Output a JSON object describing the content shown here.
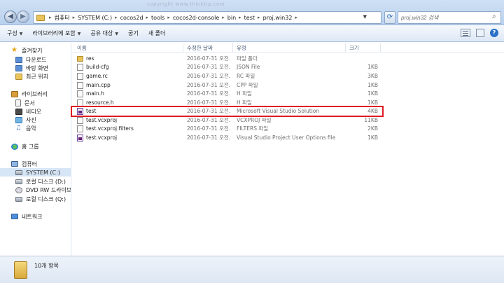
{
  "address_bar": {
    "crumbs": [
      "컴퓨터",
      "SYSTEM (C:)",
      "cocos2d",
      "tools",
      "cocos2d-console",
      "bin",
      "test",
      "proj.win32"
    ],
    "search_placeholder": "proj.win32 검색",
    "watermark": "copyright www.thinktip.com"
  },
  "toolbar": {
    "organize": "구성",
    "include_library": "라이브러리에 포함",
    "share": "공유 대상",
    "burn": "굽기",
    "new_folder": "새 폴더"
  },
  "nav": {
    "favorites": "즐겨찾기",
    "downloads": "다운로드",
    "desktop": "바탕 화면",
    "recent": "최근 위치",
    "libraries": "라이브러리",
    "documents": "문서",
    "videos": "비디오",
    "pictures": "사진",
    "music": "음악",
    "homegroup": "홈 그룹",
    "computer": "컴퓨터",
    "system_c": "SYSTEM (C:)",
    "local_d": "로컬 디스크 (D:)",
    "dvd": "DVD RW 드라이브 (",
    "local_q": "로컬 디스크 (Q:)",
    "network": "네트워크"
  },
  "columns": {
    "name": "이름",
    "date": "수정한 날짜",
    "type": "유형",
    "size": "크기"
  },
  "files": [
    {
      "name": "res",
      "date": "2016-07-31 오전...",
      "type": "파일 폴더",
      "size": "",
      "icon": "folder-icon"
    },
    {
      "name": "build-cfg",
      "date": "2016-07-31 오전...",
      "type": "JSON File",
      "size": "1KB",
      "icon": "file-icon"
    },
    {
      "name": "game.rc",
      "date": "2016-07-31 오전...",
      "type": "RC 파일",
      "size": "3KB",
      "icon": "file-icon"
    },
    {
      "name": "main.cpp",
      "date": "2016-07-31 오전...",
      "type": "CPP 파일",
      "size": "1KB",
      "icon": "file-icon"
    },
    {
      "name": "main.h",
      "date": "2016-07-31 오전...",
      "type": "H 파일",
      "size": "1KB",
      "icon": "file-icon"
    },
    {
      "name": "resource.h",
      "date": "2016-07-31 오전...",
      "type": "H 파일",
      "size": "1KB",
      "icon": "file-icon"
    },
    {
      "name": "test",
      "date": "2016-07-31 오전...",
      "type": "Microsoft Visual Studio Solution",
      "size": "4KB",
      "icon": "solution-icon"
    },
    {
      "name": "test.vcxproj",
      "date": "2016-07-31 오전...",
      "type": "VCXPROJ 파일",
      "size": "11KB",
      "icon": "file-icon"
    },
    {
      "name": "test.vcxproj.filters",
      "date": "2016-07-31 오전...",
      "type": "FILTERS 파일",
      "size": "2KB",
      "icon": "file-icon"
    },
    {
      "name": "test.vcxproj",
      "date": "2016-07-31 오전...",
      "type": "Visual Studio Project User Options file",
      "size": "1KB",
      "icon": "solution-icon"
    }
  ],
  "status": {
    "count": "10개 항목"
  },
  "highlight_color": "#e01b24"
}
